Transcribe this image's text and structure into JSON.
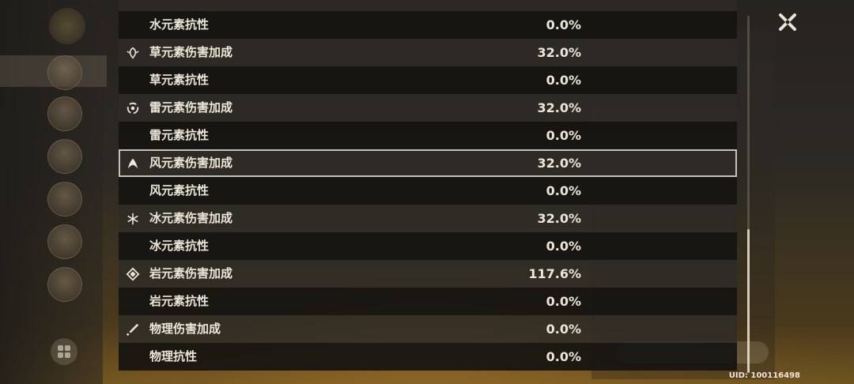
{
  "close_icon": "close-x-icon",
  "uid": "UID: 100116498",
  "stats": [
    {
      "label": "水元素抗性",
      "value": "0.0%",
      "icon": null,
      "shade": "dark"
    },
    {
      "label": "草元素伤害加成",
      "value": "32.0%",
      "icon": "dendro-icon",
      "shade": "light"
    },
    {
      "label": "草元素抗性",
      "value": "0.0%",
      "icon": null,
      "shade": "dark"
    },
    {
      "label": "雷元素伤害加成",
      "value": "32.0%",
      "icon": "electro-icon",
      "shade": "light"
    },
    {
      "label": "雷元素抗性",
      "value": "0.0%",
      "icon": null,
      "shade": "dark"
    },
    {
      "label": "风元素伤害加成",
      "value": "32.0%",
      "icon": "anemo-icon",
      "shade": "light",
      "selected": true
    },
    {
      "label": "风元素抗性",
      "value": "0.0%",
      "icon": null,
      "shade": "dark"
    },
    {
      "label": "冰元素伤害加成",
      "value": "32.0%",
      "icon": "cryo-icon",
      "shade": "light"
    },
    {
      "label": "冰元素抗性",
      "value": "0.0%",
      "icon": null,
      "shade": "dark"
    },
    {
      "label": "岩元素伤害加成",
      "value": "117.6%",
      "icon": "geo-icon",
      "shade": "light"
    },
    {
      "label": "岩元素抗性",
      "value": "0.0%",
      "icon": null,
      "shade": "dark"
    },
    {
      "label": "物理伤害加成",
      "value": "0.0%",
      "icon": "physical-icon",
      "shade": "light"
    },
    {
      "label": "物理抗性",
      "value": "0.0%",
      "icon": null,
      "shade": "dark"
    }
  ],
  "colors": {
    "text": "#ece5d8",
    "row_dark": "#161411",
    "row_light": "#2e2b26",
    "selected_border": "#e1dcd2"
  }
}
